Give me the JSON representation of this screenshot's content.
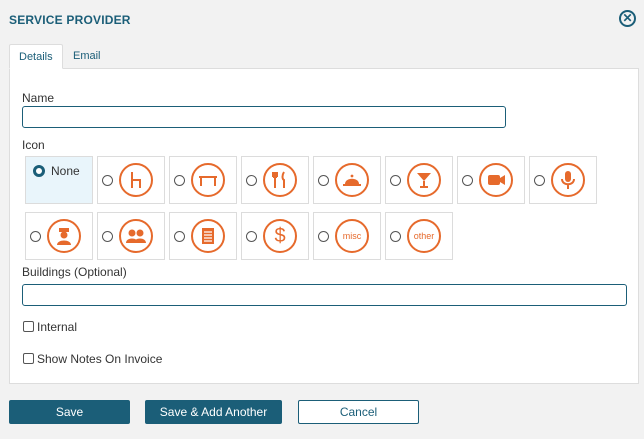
{
  "dialog": {
    "title": "SERVICE PROVIDER",
    "close_icon": "close-icon"
  },
  "tabs": [
    {
      "label": "Details",
      "active": true
    },
    {
      "label": "Email",
      "active": false
    }
  ],
  "form": {
    "name_label": "Name",
    "name_value": "",
    "icon_label": "Icon",
    "icon_none_label": "None",
    "icons": [
      "chair-icon",
      "table-icon",
      "utensils-icon",
      "cloche-icon",
      "cocktail-icon",
      "video-camera-icon",
      "microphone-icon",
      "security-person-icon",
      "people-icon",
      "clipboard-icon",
      "dollar-icon",
      "misc-icon",
      "other-icon"
    ],
    "icon_misc_text": "misc",
    "icon_other_text": "other",
    "selected_icon": "none",
    "buildings_label": "Buildings (Optional)",
    "buildings_value": "",
    "internal_label": "Internal",
    "internal_checked": false,
    "show_notes_label": "Show Notes On Invoice",
    "show_notes_checked": false
  },
  "buttons": {
    "save": "Save",
    "save_add_another": "Save & Add Another",
    "cancel": "Cancel"
  },
  "colors": {
    "primary": "#1b5e78",
    "icon_orange": "#e66a2c",
    "background": "#f2f2f2"
  }
}
